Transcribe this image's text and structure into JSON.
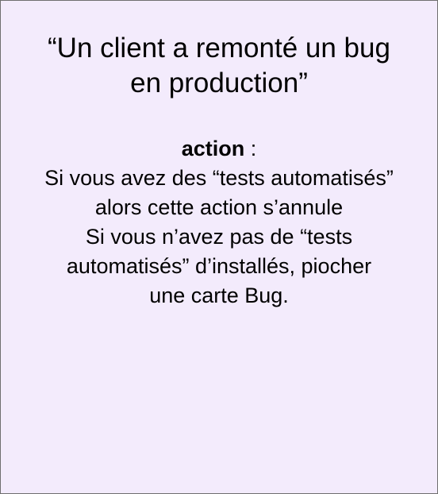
{
  "card": {
    "title_lines": [
      "“Un client a remonté un bug",
      "en production”"
    ],
    "action_label": "action",
    "action_separator": " :",
    "action_lines": [
      "Si vous avez des “tests automatisés”",
      "alors cette action s’annule",
      "Si vous n’avez pas de “tests",
      "automatisés” d’installés, piocher",
      "une carte Bug."
    ],
    "colors": {
      "background": "#f3ebfc",
      "border": "#6f6f6f",
      "text": "#000000"
    }
  }
}
